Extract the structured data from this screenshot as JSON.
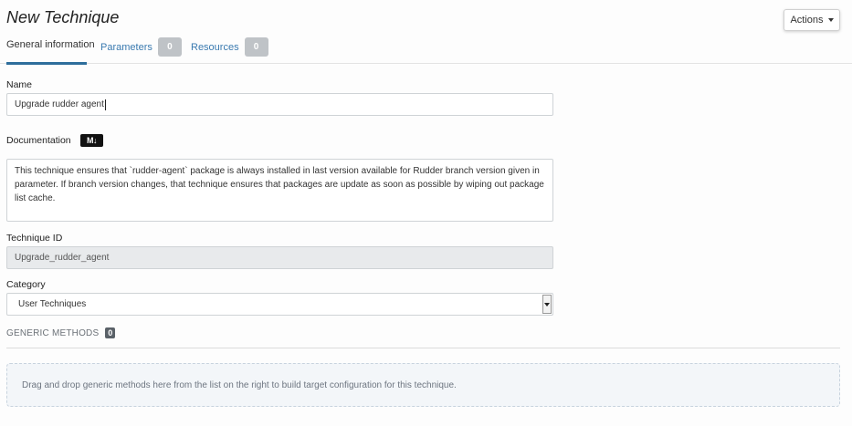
{
  "header": {
    "title": "New Technique",
    "actions_label": "Actions"
  },
  "tabs": [
    {
      "label": "General information",
      "active": true
    },
    {
      "label": "Parameters",
      "count": "0"
    },
    {
      "label": "Resources",
      "count": "0"
    }
  ],
  "form": {
    "name_label": "Name",
    "name_value": "Upgrade rudder agent",
    "documentation_label": "Documentation",
    "markdown_badge": "M↓",
    "documentation_value": "This technique ensures that `rudder-agent` package is always installed in last version available for Rudder branch version given in parameter. If branch version changes, that technique ensures that packages are update as soon as possible by wiping out package list cache.",
    "technique_id_label": "Technique ID",
    "technique_id_value": "Upgrade_rudder_agent",
    "category_label": "Category",
    "category_value": "User Techniques"
  },
  "generic_methods": {
    "header": "GENERIC METHODS",
    "count": "0",
    "dropzone_text": "Drag and drop generic methods here from the list on the right to build target configuration for this technique."
  }
}
